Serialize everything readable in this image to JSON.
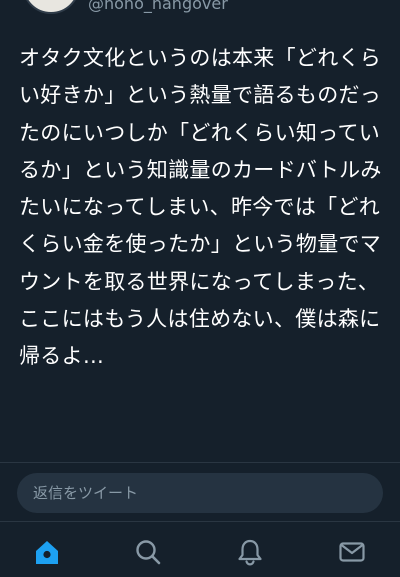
{
  "author": {
    "handle": "@nono_hangover"
  },
  "tweet": {
    "text": "オタク文化というのは本来「どれくらい好きか」という熱量で語るものだったのにいつしか「どれくらい知っているか」という知識量のカードバトルみたいになってしまい、昨今では「どれくらい金を使ったか」という物量でマウントを取る世界になってしまった、ここにはもう人は住めない、僕は森に帰るよ…"
  },
  "reply": {
    "placeholder": "返信をツイート"
  },
  "tabbar": {
    "accent_color": "#1da1f2",
    "icon_color": "#8899a6",
    "tabs": [
      {
        "icon": "home-icon",
        "active": true
      },
      {
        "icon": "search-icon",
        "active": false
      },
      {
        "icon": "bell-icon",
        "active": false
      },
      {
        "icon": "mail-icon",
        "active": false
      }
    ]
  }
}
